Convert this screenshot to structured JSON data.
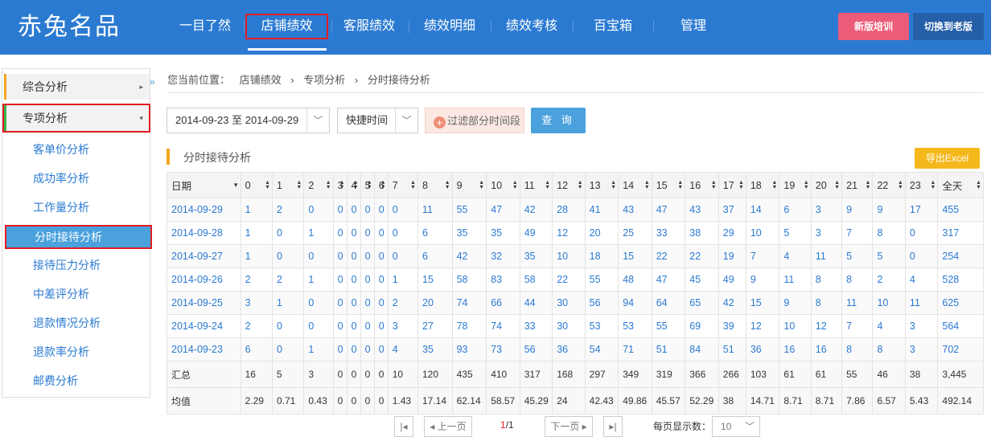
{
  "header": {
    "logo": "赤兔名品",
    "nav": [
      "一目了然",
      "店铺绩效",
      "客服绩效",
      "绩效明细",
      "绩效考核",
      "百宝箱",
      "管理"
    ],
    "active_nav": "店铺绩效",
    "btn_training": "新版培训",
    "btn_old": "切换到老版",
    "colors": {
      "header_bg": "#2b7ad2",
      "training_bg": "#ec5b78",
      "old_bg": "#245fa8"
    }
  },
  "sidebar": {
    "group1": "综合分析",
    "group2": "专项分析",
    "items": [
      "客单价分析",
      "成功率分析",
      "工作量分析",
      "分时接待分析",
      "接待压力分析",
      "中差评分析",
      "退款情况分析",
      "退款率分析",
      "邮费分析"
    ],
    "selected": "分时接待分析",
    "collapse_icon": "»"
  },
  "breadcrumb": {
    "label": "您当前位置：",
    "path": [
      "店铺绩效",
      "专项分析",
      "分时接待分析"
    ],
    "sep": "›"
  },
  "filters": {
    "date_range": "2014-09-23 至 2014-09-29",
    "quick_time": "快捷时间",
    "filter_label": "过滤部分时间段",
    "query_label": "查 询"
  },
  "section": {
    "title": "分时接待分析",
    "export_label": "导出Excel"
  },
  "table": {
    "headers": [
      "日期",
      "0",
      "1",
      "2",
      "3",
      "4",
      "5",
      "6",
      "7",
      "8",
      "9",
      "10",
      "11",
      "12",
      "13",
      "14",
      "15",
      "16",
      "17",
      "18",
      "19",
      "20",
      "21",
      "22",
      "23",
      "全天"
    ],
    "rows": [
      [
        "2014-09-29",
        "1",
        "2",
        "0",
        "0",
        "0",
        "0",
        "0",
        "0",
        "11",
        "55",
        "47",
        "42",
        "28",
        "41",
        "43",
        "47",
        "43",
        "37",
        "14",
        "6",
        "3",
        "9",
        "9",
        "17",
        "455"
      ],
      [
        "2014-09-28",
        "1",
        "0",
        "1",
        "0",
        "0",
        "0",
        "0",
        "0",
        "6",
        "35",
        "35",
        "49",
        "12",
        "20",
        "25",
        "33",
        "38",
        "29",
        "10",
        "5",
        "3",
        "7",
        "8",
        "0",
        "317"
      ],
      [
        "2014-09-27",
        "1",
        "0",
        "0",
        "0",
        "0",
        "0",
        "0",
        "0",
        "6",
        "42",
        "32",
        "35",
        "10",
        "18",
        "15",
        "22",
        "22",
        "19",
        "7",
        "4",
        "11",
        "5",
        "5",
        "0",
        "254"
      ],
      [
        "2014-09-26",
        "2",
        "2",
        "1",
        "0",
        "0",
        "0",
        "0",
        "1",
        "15",
        "58",
        "83",
        "58",
        "22",
        "55",
        "48",
        "47",
        "45",
        "49",
        "9",
        "11",
        "8",
        "8",
        "2",
        "4",
        "528"
      ],
      [
        "2014-09-25",
        "3",
        "1",
        "0",
        "0",
        "0",
        "0",
        "0",
        "2",
        "20",
        "74",
        "66",
        "44",
        "30",
        "56",
        "94",
        "64",
        "65",
        "42",
        "15",
        "9",
        "8",
        "11",
        "10",
        "11",
        "625"
      ],
      [
        "2014-09-24",
        "2",
        "0",
        "0",
        "0",
        "0",
        "0",
        "0",
        "3",
        "27",
        "78",
        "74",
        "33",
        "30",
        "53",
        "53",
        "55",
        "69",
        "39",
        "12",
        "10",
        "12",
        "7",
        "4",
        "3",
        "564"
      ],
      [
        "2014-09-23",
        "6",
        "0",
        "1",
        "0",
        "0",
        "0",
        "0",
        "4",
        "35",
        "93",
        "73",
        "56",
        "36",
        "54",
        "71",
        "51",
        "84",
        "51",
        "36",
        "16",
        "16",
        "8",
        "8",
        "3",
        "702"
      ]
    ],
    "summary": [
      [
        "汇总",
        "16",
        "5",
        "3",
        "0",
        "0",
        "0",
        "0",
        "10",
        "120",
        "435",
        "410",
        "317",
        "168",
        "297",
        "349",
        "319",
        "366",
        "266",
        "103",
        "61",
        "61",
        "55",
        "46",
        "38",
        "3,445"
      ],
      [
        "均值",
        "2.29",
        "0.71",
        "0.43",
        "0",
        "0",
        "0",
        "0",
        "1.43",
        "17.14",
        "62.14",
        "58.57",
        "45.29",
        "24",
        "42.43",
        "49.86",
        "45.57",
        "52.29",
        "38",
        "14.71",
        "8.71",
        "8.71",
        "7.86",
        "6.57",
        "5.43",
        "492.14"
      ]
    ]
  },
  "pager": {
    "first": "|◂",
    "prev": "◂ 上一页",
    "current": "1",
    "total": "/1",
    "next": "下一页 ▸",
    "last": "▸|",
    "page_size_label": "每页显示数：",
    "page_size": "10"
  }
}
